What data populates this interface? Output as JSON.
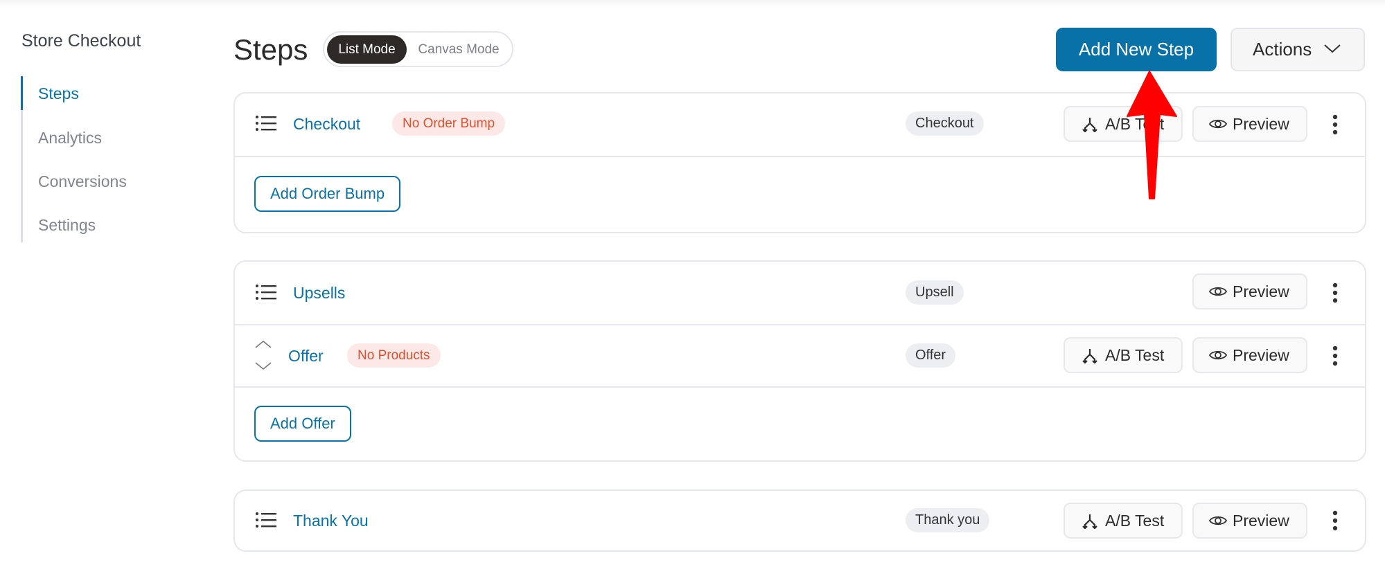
{
  "sidebar": {
    "title": "Store Checkout",
    "items": [
      {
        "label": "Steps",
        "active": true
      },
      {
        "label": "Analytics",
        "active": false
      },
      {
        "label": "Conversions",
        "active": false
      },
      {
        "label": "Settings",
        "active": false
      }
    ]
  },
  "header": {
    "title": "Steps",
    "modes": [
      {
        "label": "List Mode",
        "selected": true
      },
      {
        "label": "Canvas Mode",
        "selected": false
      }
    ],
    "add_step_label": "Add New Step",
    "actions_label": "Actions"
  },
  "steps": [
    {
      "name": "Checkout",
      "warning": "No Order Bump",
      "type": "Checkout",
      "ab_label": "A/B Test",
      "preview_label": "Preview",
      "add_label": "Add Order Bump"
    },
    {
      "name": "Upsells",
      "type": "Upsell",
      "preview_label": "Preview",
      "offer": {
        "name": "Offer",
        "warning": "No Products",
        "type": "Offer",
        "ab_label": "A/B Test",
        "preview_label": "Preview"
      },
      "add_label": "Add Offer"
    },
    {
      "name": "Thank You",
      "type": "Thank you",
      "ab_label": "A/B Test",
      "preview_label": "Preview"
    }
  ],
  "colors": {
    "accent": "#0873a8",
    "warning_text": "#e0502c",
    "warning_bg": "#fde8e8",
    "annotation_arrow": "#ff0000"
  }
}
